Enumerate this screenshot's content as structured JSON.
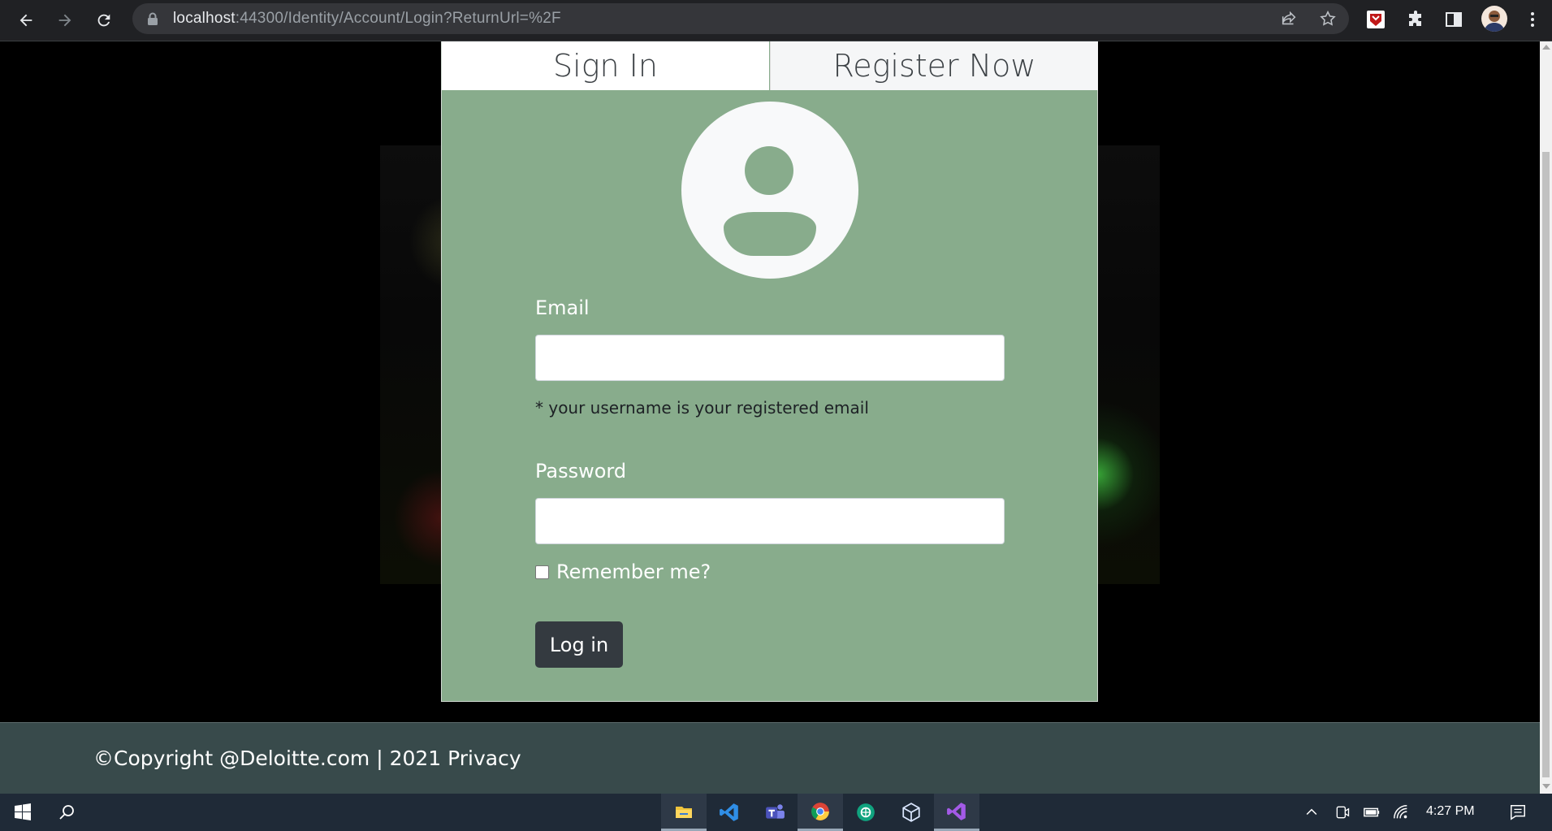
{
  "browser": {
    "url_host": "localhost",
    "url_rest": ":44300/Identity/Account/Login?ReturnUrl=%2F"
  },
  "tabs": {
    "sign_in": "Sign In",
    "register": "Register Now"
  },
  "form": {
    "email_label": "Email",
    "email_value": "",
    "hint": "* your username is your registered email",
    "password_label": "Password",
    "password_value": "",
    "remember_label": "Remember me?",
    "login_button": "Log in"
  },
  "footer": {
    "text": "©Copyright @Deloitte.com | 2021 Privacy"
  },
  "taskbar": {
    "time": "4:27 PM",
    "apps": [
      "file-explorer",
      "vs-code",
      "teams",
      "chrome",
      "openai-app",
      "virtualbox-app",
      "visual-studio"
    ]
  },
  "colors": {
    "card_bg": "#88ac8c",
    "footer_bg": "#384a4b",
    "button_bg": "#343a40",
    "taskbar_bg": "#1f2a37"
  }
}
